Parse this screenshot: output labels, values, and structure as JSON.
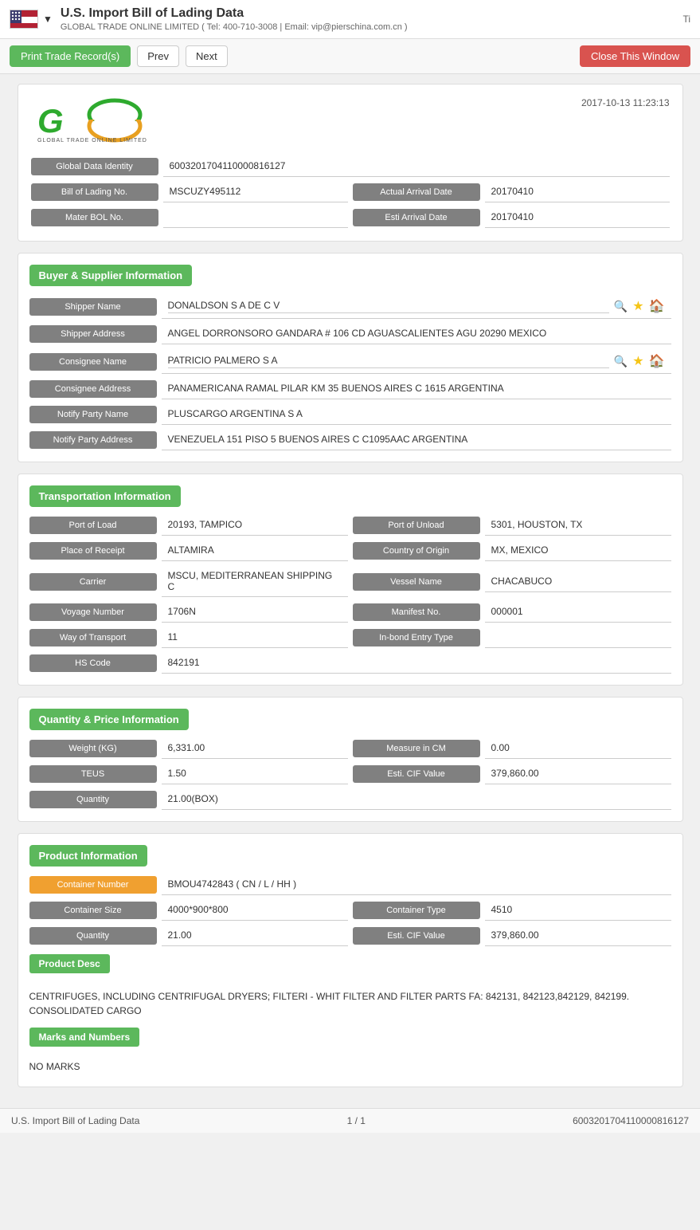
{
  "app": {
    "title": "U.S. Import Bill of Lading Data",
    "subtitle": "GLOBAL TRADE ONLINE LIMITED ( Tel: 400-710-3008 | Email: vip@pierschina.com.cn )",
    "top_right": "Ti"
  },
  "toolbar": {
    "print_label": "Print Trade Record(s)",
    "prev_label": "Prev",
    "next_label": "Next",
    "close_label": "Close This Window"
  },
  "record": {
    "datetime": "2017-10-13 11:23:13",
    "logo_text": "GLOBAL TRADE ONLINE LIMITED",
    "fields": {
      "global_data_identity_label": "Global Data Identity",
      "global_data_identity_value": "6003201704110000816127",
      "bill_of_lading_label": "Bill of Lading No.",
      "bill_of_lading_value": "MSCUZY495112",
      "actual_arrival_label": "Actual Arrival Date",
      "actual_arrival_value": "20170410",
      "mater_bol_label": "Mater BOL No.",
      "mater_bol_value": "",
      "esti_arrival_label": "Esti Arrival Date",
      "esti_arrival_value": "20170410"
    }
  },
  "buyer_supplier": {
    "section_title": "Buyer & Supplier Information",
    "shipper_name_label": "Shipper Name",
    "shipper_name_value": "DONALDSON S A DE C V",
    "shipper_address_label": "Shipper Address",
    "shipper_address_value": "ANGEL DORRONSORO GANDARA # 106 CD AGUASCALIENTES AGU 20290 MEXICO",
    "consignee_name_label": "Consignee Name",
    "consignee_name_value": "PATRICIO PALMERO S A",
    "consignee_address_label": "Consignee Address",
    "consignee_address_value": "PANAMERICANA RAMAL PILAR KM 35 BUENOS AIRES C 1615 ARGENTINA",
    "notify_party_name_label": "Notify Party Name",
    "notify_party_name_value": "PLUSCARGO ARGENTINA S A",
    "notify_party_address_label": "Notify Party Address",
    "notify_party_address_value": "VENEZUELA 151 PISO 5 BUENOS AIRES C C1095AAC ARGENTINA"
  },
  "transportation": {
    "section_title": "Transportation Information",
    "port_of_load_label": "Port of Load",
    "port_of_load_value": "20193, TAMPICO",
    "port_of_unload_label": "Port of Unload",
    "port_of_unload_value": "5301, HOUSTON, TX",
    "place_of_receipt_label": "Place of Receipt",
    "place_of_receipt_value": "ALTAMIRA",
    "country_of_origin_label": "Country of Origin",
    "country_of_origin_value": "MX, MEXICO",
    "carrier_label": "Carrier",
    "carrier_value": "MSCU, MEDITERRANEAN SHIPPING C",
    "vessel_name_label": "Vessel Name",
    "vessel_name_value": "CHACABUCO",
    "voyage_number_label": "Voyage Number",
    "voyage_number_value": "1706N",
    "manifest_no_label": "Manifest No.",
    "manifest_no_value": "000001",
    "way_of_transport_label": "Way of Transport",
    "way_of_transport_value": "11",
    "inbond_entry_label": "In-bond Entry Type",
    "inbond_entry_value": "",
    "hs_code_label": "HS Code",
    "hs_code_value": "842191"
  },
  "quantity_price": {
    "section_title": "Quantity & Price Information",
    "weight_label": "Weight (KG)",
    "weight_value": "6,331.00",
    "measure_label": "Measure in CM",
    "measure_value": "0.00",
    "teus_label": "TEUS",
    "teus_value": "1.50",
    "esti_cif_label": "Esti. CIF Value",
    "esti_cif_value": "379,860.00",
    "quantity_label": "Quantity",
    "quantity_value": "21.00(BOX)"
  },
  "product": {
    "section_title": "Product Information",
    "container_number_label": "Container Number",
    "container_number_value": "BMOU4742843 ( CN / L / HH )",
    "container_size_label": "Container Size",
    "container_size_value": "4000*900*800",
    "container_type_label": "Container Type",
    "container_type_value": "4510",
    "quantity_label": "Quantity",
    "quantity_value": "21.00",
    "esti_cif_label": "Esti. CIF Value",
    "esti_cif_value": "379,860.00",
    "product_desc_label": "Product Desc",
    "product_desc_value": "CENTRIFUGES, INCLUDING CENTRIFUGAL DRYERS; FILTERI - WHIT FILTER AND FILTER PARTS FA: 842131, 842123,842129, 842199.\nCONSOLIDATED CARGO",
    "marks_label": "Marks and Numbers",
    "marks_value": "NO MARKS"
  },
  "footer": {
    "left": "U.S. Import Bill of Lading Data",
    "center": "1 / 1",
    "right": "6003201704110000816127"
  },
  "colors": {
    "green": "#5cb85c",
    "orange": "#f0a030",
    "gray": "#808080",
    "red": "#d9534f"
  }
}
